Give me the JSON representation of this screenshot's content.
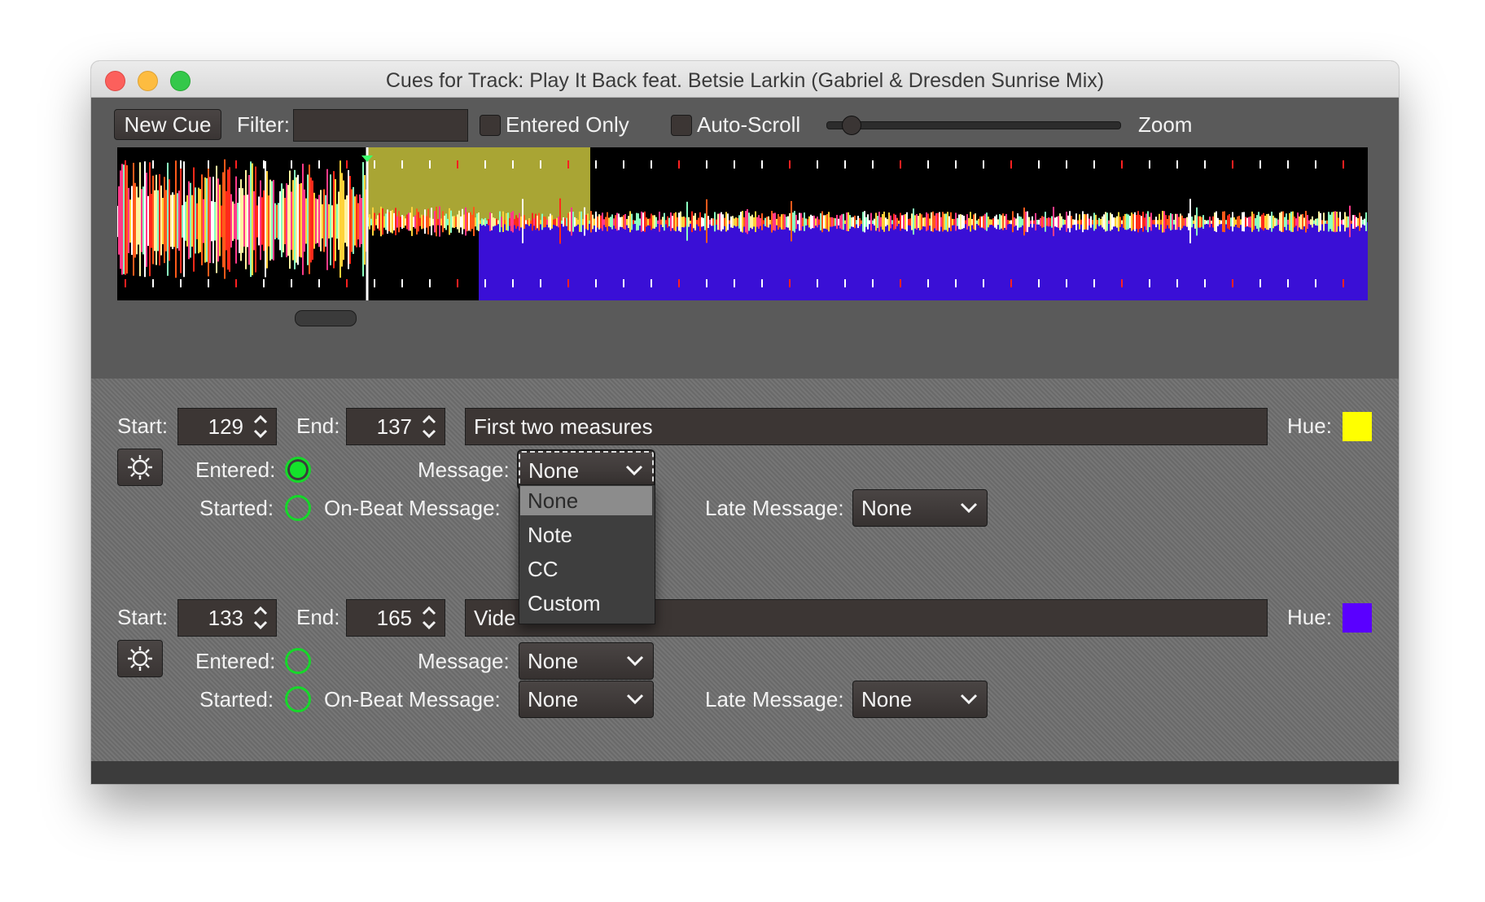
{
  "window": {
    "title": "Cues for Track: Play It Back feat. Betsie Larkin (Gabriel & Dresden Sunrise Mix)"
  },
  "toolbar": {
    "new_cue_label": "New Cue",
    "filter_label": "Filter:",
    "filter_value": "",
    "entered_only_label": "Entered Only",
    "entered_only_checked": false,
    "auto_scroll_label": "Auto-Scroll",
    "auto_scroll_checked": false,
    "zoom_label": "Zoom",
    "zoom_level": 0.06
  },
  "waveform": {
    "colors": {
      "cue1_highlight": "#a9a534",
      "cue2_highlight": "#3a0fd6",
      "playhead": "#ffffff"
    }
  },
  "cues": [
    {
      "start_label": "Start:",
      "start": "129",
      "end_label": "End:",
      "end": "137",
      "comment": "First two measures",
      "hue_label": "Hue:",
      "hue_color": "#ffff00",
      "entered_label": "Entered:",
      "entered": true,
      "started_label": "Started:",
      "started": false,
      "message_label": "Message:",
      "message": "None",
      "on_beat_label": "On-Beat Message:",
      "on_beat": "None",
      "late_label": "Late Message:",
      "late": "None"
    },
    {
      "start_label": "Start:",
      "start": "133",
      "end_label": "End:",
      "end": "165",
      "comment": "Vide",
      "hue_label": "Hue:",
      "hue_color": "#5a00ff",
      "entered_label": "Entered:",
      "entered": false,
      "started_label": "Started:",
      "started": false,
      "message_label": "Message:",
      "message": "None",
      "on_beat_label": "On-Beat Message:",
      "on_beat": "None",
      "late_label": "Late Message:",
      "late": "None"
    }
  ],
  "dropdown": {
    "options": [
      "None",
      "Note",
      "CC",
      "Custom"
    ],
    "selected": "None"
  },
  "icons": [
    "gear-icon",
    "chevron-down-icon",
    "spinner-arrows-icon"
  ]
}
